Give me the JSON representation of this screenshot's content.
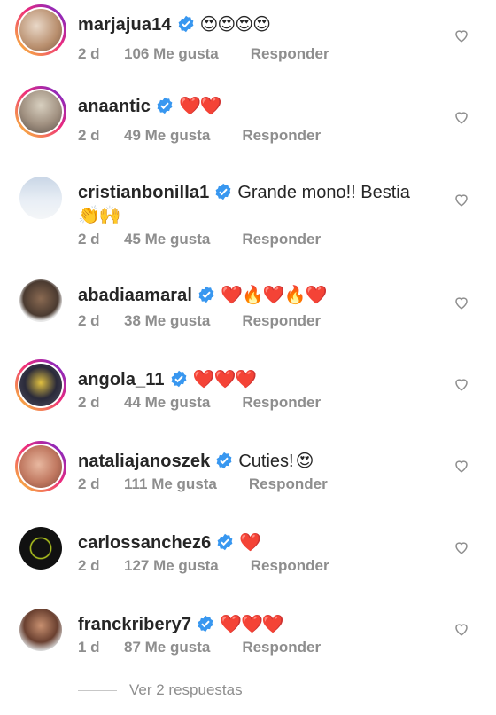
{
  "comments": [
    {
      "username": "marjajua14",
      "text": "",
      "emoji": "😍😍😍😍",
      "time": "2 d",
      "likes": "106 Me gusta",
      "reply": "Responder"
    },
    {
      "username": "anaantic",
      "text": "",
      "emoji": "❤️❤️",
      "time": "2 d",
      "likes": "49 Me gusta",
      "reply": "Responder"
    },
    {
      "username": "cristianbonilla1",
      "text": "Grande mono!! Bestia",
      "emoji": "👏🙌",
      "time": "2 d",
      "likes": "45 Me gusta",
      "reply": "Responder"
    },
    {
      "username": "abadiaamaral",
      "text": "",
      "emoji": "❤️🔥❤️🔥❤️",
      "time": "2 d",
      "likes": "38 Me gusta",
      "reply": "Responder"
    },
    {
      "username": "angola_11",
      "text": "",
      "emoji": "❤️❤️❤️",
      "time": "2 d",
      "likes": "44 Me gusta",
      "reply": "Responder"
    },
    {
      "username": "nataliajanoszek",
      "text": "Cuties!",
      "emoji": "😍",
      "time": "2 d",
      "likes": "111 Me gusta",
      "reply": "Responder"
    },
    {
      "username": "carlossanchez6",
      "text": "",
      "emoji": "❤️",
      "time": "2 d",
      "likes": "127 Me gusta",
      "reply": "Responder"
    },
    {
      "username": "franckribery7",
      "text": "",
      "emoji": "❤️❤️❤️",
      "time": "1 d",
      "likes": "87 Me gusta",
      "reply": "Responder"
    }
  ],
  "view_replies": "Ver 2 respuestas",
  "icons": {
    "verified": "verified-badge-icon",
    "like": "heart-outline-icon"
  },
  "colors": {
    "verified": "#3897f0",
    "meta": "#8e8e8e",
    "text": "#262626"
  }
}
